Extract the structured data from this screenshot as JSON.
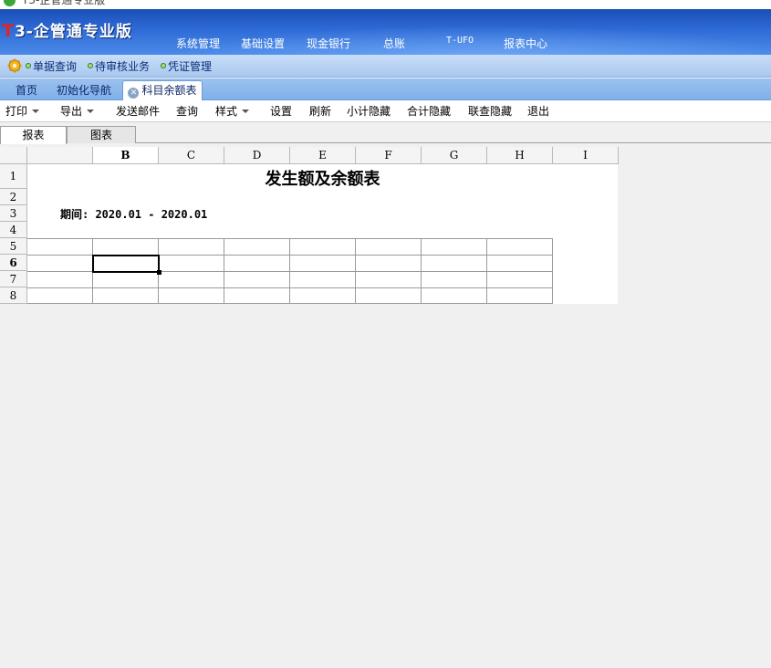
{
  "title_bar": {
    "text": "T3-企管通专业版"
  },
  "banner": {
    "logo_t": "T",
    "logo_rest": "3-企管通专业版",
    "nav": [
      "系统管理",
      "基础设置",
      "现金银行",
      "总账",
      "T-UFO",
      "报表中心"
    ]
  },
  "quickbar": {
    "items": [
      "单据查询",
      "待审核业务",
      "凭证管理"
    ]
  },
  "tabs": [
    {
      "label": "首页"
    },
    {
      "label": "初始化导航"
    },
    {
      "label": "科目余额表",
      "active": true,
      "close_icon": "close-icon"
    }
  ],
  "toolbar": {
    "items": [
      {
        "label": "打印",
        "dropdown": true
      },
      {
        "label": "导出",
        "dropdown": true
      },
      {
        "label": "发送邮件"
      },
      {
        "label": "查询"
      },
      {
        "label": "样式",
        "dropdown": true
      },
      {
        "label": "设置"
      },
      {
        "label": "刷新"
      },
      {
        "label": "小计隐藏"
      },
      {
        "label": "合计隐藏"
      },
      {
        "label": "联查隐藏"
      },
      {
        "label": "退出"
      }
    ]
  },
  "subtabs": [
    {
      "label": "报表",
      "active": true
    },
    {
      "label": "图表"
    }
  ],
  "sheet": {
    "columns": [
      "B",
      "C",
      "D",
      "E",
      "F",
      "G",
      "H",
      "I"
    ],
    "rows": [
      "1",
      "2",
      "3",
      "4",
      "5",
      "6",
      "7",
      "8"
    ],
    "selected_column": "B",
    "selected_row": "6",
    "title": "发生额及余额表",
    "period_label": "期间: 2020.01 - 2020.01"
  },
  "colors": {
    "banner_blue": "#2f6bd6",
    "tab_blue": "#7fb0ea",
    "logo_red": "#e52320"
  }
}
